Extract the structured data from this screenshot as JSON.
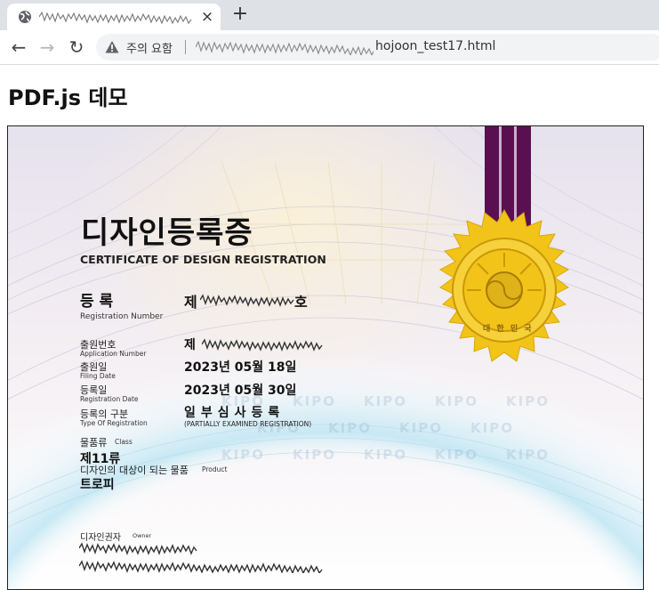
{
  "browser": {
    "tab_title": "",
    "close_glyph": "×",
    "newtab_glyph": "+",
    "nav": {
      "back": "←",
      "forward": "→",
      "reload": "↻"
    },
    "security_label": "주의 요함",
    "url_path": "hojoon_test17.html",
    "icons": [
      "globe-icon",
      "warning-icon",
      "close-icon",
      "plus-icon",
      "back-arrow-icon",
      "forward-arrow-icon",
      "reload-icon"
    ]
  },
  "page": {
    "heading": "PDF.js 데모"
  },
  "certificate": {
    "title_ko": "디자인등록증",
    "title_en": "CERTIFICATE OF DESIGN REGISTRATION",
    "reg_label_ko": "등 록",
    "reg_label_en": "Registration Number",
    "reg_prefix": "제",
    "reg_suffix": "호",
    "app_label_ko": "출원번호",
    "app_label_en": "Application Number",
    "app_prefix": "제",
    "filing_label_ko": "출원일",
    "filing_label_en": "Filing Date",
    "filing_value": "2023년 05월 18일",
    "regdate_label_ko": "등록일",
    "regdate_label_en": "Registration Date",
    "regdate_value": "2023년 05월 30일",
    "type_label_ko": "등록의 구분",
    "type_label_en": "Type Of Registration",
    "type_value": "일부심사등록",
    "type_note": "(PARTIALLY EXAMINED REGISTRATION)",
    "class_label_ko": "물품류",
    "class_label_en": "Class",
    "class_value": "제11류",
    "product_label_ko": "디자인의 대상이 되는 물품",
    "product_label_en": "Product",
    "product_value": "트로피",
    "owner_label_ko": "디자인권자",
    "owner_label_en": "Owner",
    "seal_text": "대 한 민 국",
    "watermark": "KIPO",
    "colors": {
      "ribbon": "#5a1050",
      "seal_gold": "#f2c419",
      "seal_dark": "#c9980a"
    }
  }
}
